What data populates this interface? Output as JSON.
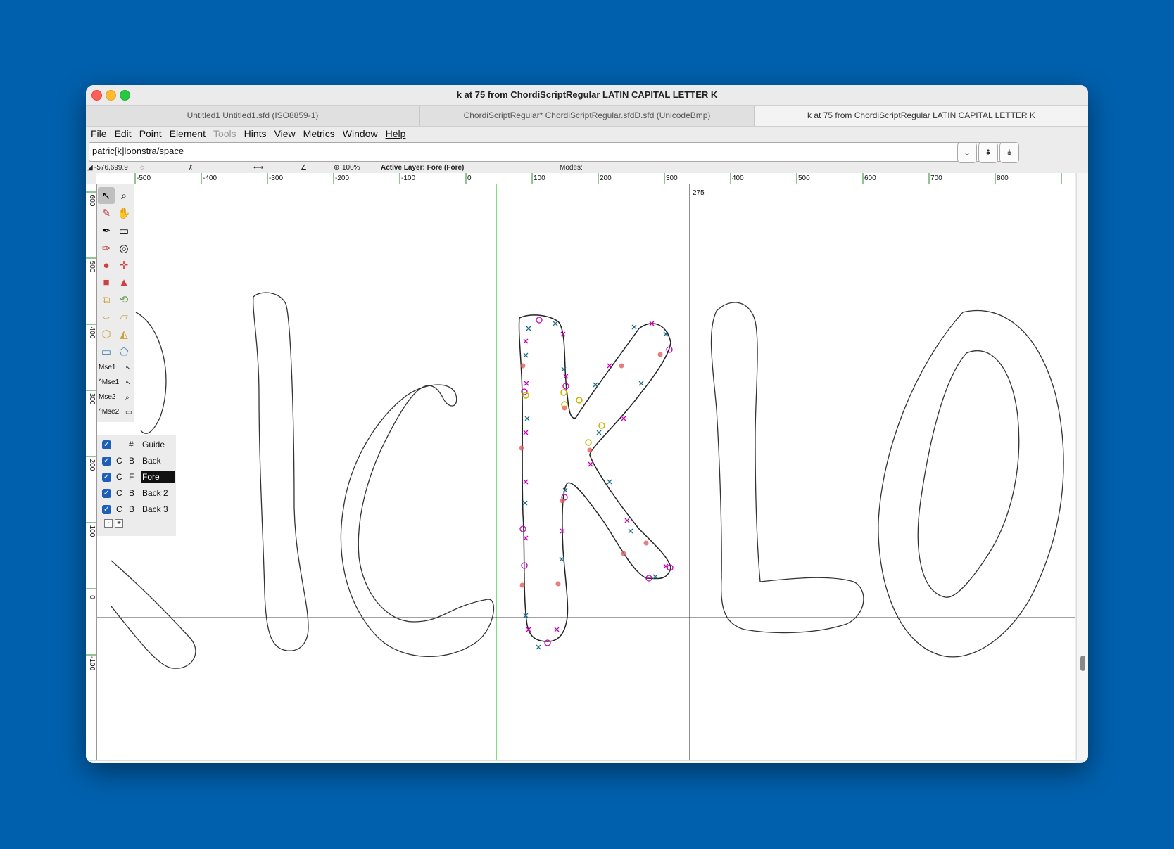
{
  "window": {
    "title": "k at 75 from ChordiScriptRegular LATIN CAPITAL LETTER K",
    "traffic_lights": [
      "close",
      "minimize",
      "zoom"
    ]
  },
  "tabs": [
    {
      "label": "Untitled1  Untitled1.sfd (ISO8859-1)"
    },
    {
      "label": "ChordiScriptRegular*  ChordiScriptRegular.sfdD.sfd (UnicodeBmp)"
    },
    {
      "label": "k at 75 from ChordiScriptRegular LATIN CAPITAL LETTER K"
    }
  ],
  "menu": [
    {
      "label": "File",
      "enabled": true
    },
    {
      "label": "Edit",
      "enabled": true
    },
    {
      "label": "Point",
      "enabled": true
    },
    {
      "label": "Element",
      "enabled": true
    },
    {
      "label": "Tools",
      "enabled": false
    },
    {
      "label": "Hints",
      "enabled": true
    },
    {
      "label": "View",
      "enabled": true
    },
    {
      "label": "Metrics",
      "enabled": true
    },
    {
      "label": "Window",
      "enabled": true
    },
    {
      "label": "Help",
      "enabled": true
    }
  ],
  "glyph_field": {
    "value": "patric[k]loonstra/space"
  },
  "glyph_buttons": [
    "⌄",
    "⇞",
    "⇟"
  ],
  "info": {
    "coords": "-576,699.9",
    "zoom": "100%",
    "active_layer": "Active Layer: Fore (Fore)",
    "modes": "Modes:"
  },
  "ruler": {
    "h_ticks": [
      "-500",
      "-400",
      "-300",
      "-200",
      "-100",
      "0",
      "100",
      "200",
      "300",
      "400",
      "500",
      "600",
      "700",
      "800"
    ],
    "v_ticks": [
      "600",
      "500",
      "400",
      "300",
      "200",
      "100",
      "0",
      "-100"
    ],
    "advance_label": "275"
  },
  "tools": {
    "icons": [
      "pointer-icon",
      "magnify-icon",
      "freehand-icon",
      "scroll-hand-icon",
      "knife-icon",
      "ruler-icon",
      "pen-icon",
      "spiro-icon",
      "curve-point-icon",
      "hv-curve-point-icon",
      "corner-point-icon",
      "tangent-point-icon",
      "scale-icon",
      "rotate-icon",
      "flip-icon",
      "skew-icon",
      "3d-rotate-icon",
      "perspective-icon",
      "rectangle-icon",
      "polygon-icon"
    ],
    "mouse_labels": [
      "Mse1",
      "^Mse1",
      "Mse2",
      "^Mse2"
    ]
  },
  "layers": [
    {
      "checked": true,
      "c": "",
      "b": "#",
      "name": "Guide",
      "selected": false
    },
    {
      "checked": true,
      "c": "C",
      "b": "B",
      "name": "Back",
      "selected": false
    },
    {
      "checked": true,
      "c": "C",
      "b": "F",
      "name": "Fore",
      "selected": true
    },
    {
      "checked": true,
      "c": "C",
      "b": "B",
      "name": "Back 2",
      "selected": false
    },
    {
      "checked": true,
      "c": "C",
      "b": "B",
      "name": "Back 3",
      "selected": false
    }
  ],
  "layer_buttons": [
    "-",
    "+"
  ],
  "colors": {
    "desktop": "#0060ad",
    "point_magenta": "#c400b8",
    "point_teal": "#1d6f8a",
    "point_red": "#e06060",
    "point_yellow": "#c8b400",
    "origin_line": "#00c000"
  }
}
